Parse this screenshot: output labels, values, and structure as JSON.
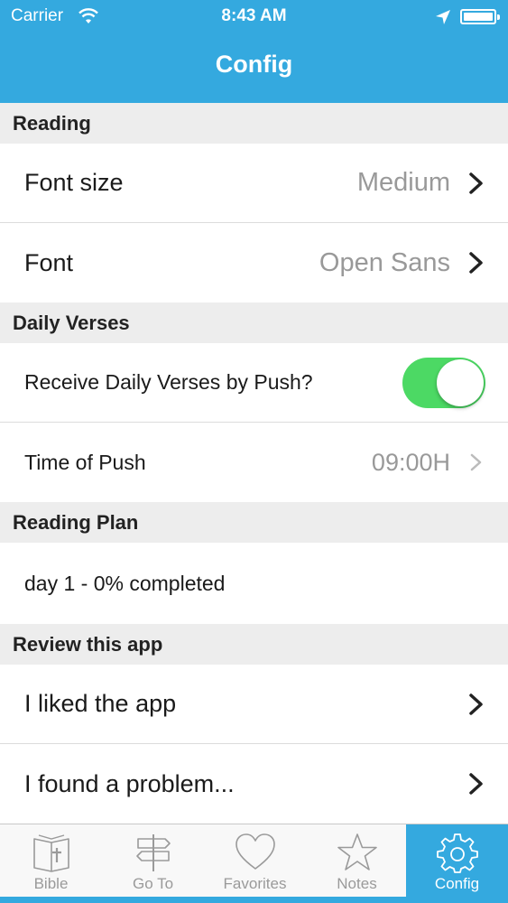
{
  "status_bar": {
    "carrier": "Carrier",
    "time": "8:43 AM"
  },
  "nav": {
    "title": "Config"
  },
  "sections": [
    {
      "header": "Reading"
    },
    {
      "header": "Daily Verses"
    },
    {
      "header": "Reading Plan"
    },
    {
      "header": "Review this app"
    }
  ],
  "reading": {
    "font_size": {
      "label": "Font size",
      "value": "Medium"
    },
    "font": {
      "label": "Font",
      "value": "Open Sans"
    }
  },
  "daily_verses": {
    "push": {
      "label": "Receive Daily Verses by Push?",
      "enabled": true
    },
    "time": {
      "label": "Time of Push",
      "value": "09:00H"
    }
  },
  "reading_plan": {
    "progress": "day 1 - 0% completed"
  },
  "review": {
    "liked": {
      "label": "I liked the app"
    },
    "problem": {
      "label": "I found a problem..."
    }
  },
  "tabs": [
    {
      "label": "Bible",
      "icon": "bible-icon",
      "active": false
    },
    {
      "label": "Go To",
      "icon": "signpost-icon",
      "active": false
    },
    {
      "label": "Favorites",
      "icon": "heart-icon",
      "active": false
    },
    {
      "label": "Notes",
      "icon": "star-icon",
      "active": false
    },
    {
      "label": "Config",
      "icon": "gear-icon",
      "active": true
    }
  ],
  "colors": {
    "accent": "#34a9df",
    "toggle_on": "#4cd964",
    "section_bg": "#ededed",
    "value_text": "#999999"
  }
}
